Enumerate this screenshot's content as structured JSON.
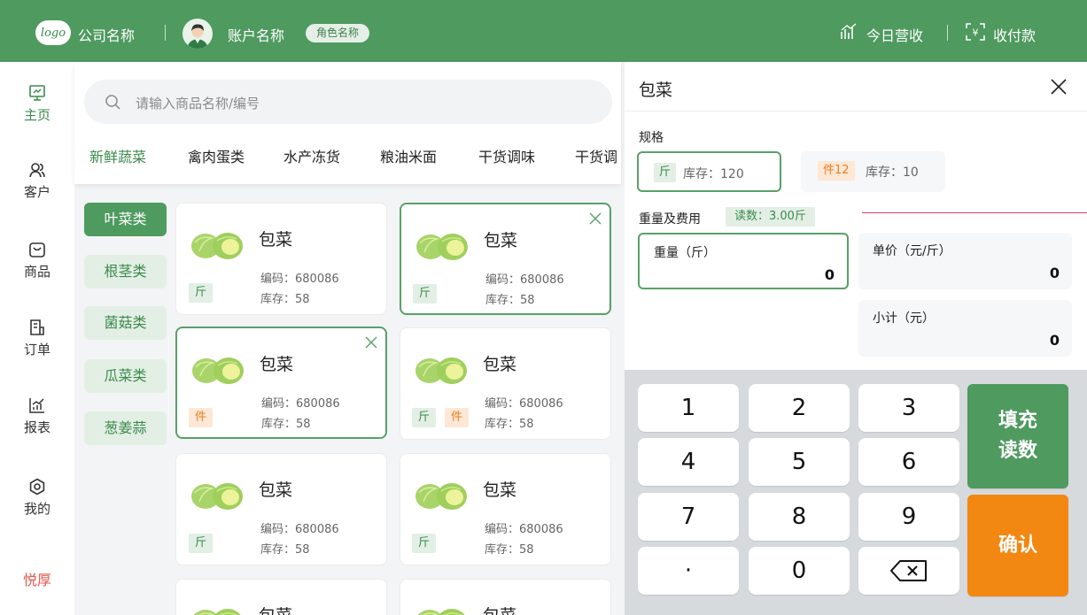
{
  "header": {
    "logo_text": "logo",
    "company": "公司名称",
    "account": "账户名称",
    "role": "角色名称",
    "income": "今日营收",
    "pay": "收付款"
  },
  "sidebar": {
    "items": [
      {
        "label": "主页",
        "icon": "monitor-icon",
        "active": true
      },
      {
        "label": "客户",
        "icon": "users-icon",
        "active": false
      },
      {
        "label": "商品",
        "icon": "bag-icon",
        "active": false
      },
      {
        "label": "订单",
        "icon": "order-icon",
        "active": false
      },
      {
        "label": "报表",
        "icon": "chart-icon",
        "active": false
      },
      {
        "label": "我的",
        "icon": "gear-icon",
        "active": false
      }
    ],
    "brand": "悦厚"
  },
  "search": {
    "placeholder": "请输入商品名称/编号"
  },
  "categories": [
    "新鲜蔬菜",
    "禽肉蛋类",
    "水产冻货",
    "粮油米面",
    "干货调味",
    "干货调"
  ],
  "subcategories": [
    "叶菜类",
    "根茎类",
    "菌菇类",
    "瓜菜类",
    "葱姜蒜"
  ],
  "products": [
    {
      "name": "包菜",
      "code": "编码：680086",
      "stock": "库存：58",
      "tags": [
        "斤"
      ]
    },
    {
      "name": "包菜",
      "code": "编码：680086",
      "stock": "库存：58",
      "tags": [
        "斤"
      ]
    },
    {
      "name": "包菜",
      "code": "编码：680086",
      "stock": "库存：58",
      "tags": [
        "件"
      ]
    },
    {
      "name": "包菜",
      "code": "编码：680086",
      "stock": "库存：58",
      "tags": [
        "斤",
        "件"
      ]
    },
    {
      "name": "包菜",
      "code": "编码：680086",
      "stock": "库存：58",
      "tags": [
        "斤"
      ]
    },
    {
      "name": "包菜",
      "code": "编码：680086",
      "stock": "库存：58",
      "tags": [
        "斤"
      ]
    },
    {
      "name": "包菜"
    },
    {
      "name": "包菜"
    }
  ],
  "detail": {
    "title": "包菜",
    "spec_label": "规格",
    "specs": [
      {
        "tag": "斤",
        "stock": "库存：120"
      },
      {
        "tag": "件12",
        "stock": "库存：10"
      }
    ],
    "weight_label": "重量及费用",
    "reading": "读数：3.00斤",
    "weight": {
      "label": "重量（斤）",
      "value": "0"
    },
    "price": {
      "label": "单价（元/斤）",
      "value": "0"
    },
    "subtotal": {
      "label": "小计（元）",
      "value": "0"
    }
  },
  "keypad": {
    "keys": [
      "1",
      "2",
      "3",
      "4",
      "5",
      "6",
      "7",
      "8",
      "9",
      "·",
      "0"
    ],
    "fill_label": "填充\n读数",
    "confirm_label": "确认"
  },
  "colors": {
    "brand_green": "#4e9a5f",
    "accent_orange": "#f28712",
    "tag_orange": "#f07d21"
  }
}
